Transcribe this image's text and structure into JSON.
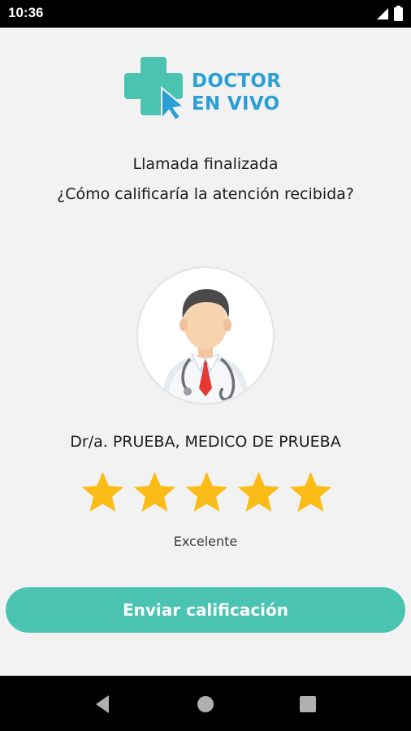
{
  "status_bar": {
    "time": "10:36"
  },
  "logo": {
    "line1": "DOCTOR",
    "line2": "EN VIVO",
    "brand_teal": "#4ac3b1",
    "brand_blue": "#2a9fd6"
  },
  "call": {
    "ended_text": "Llamada finalizada",
    "question": "¿Cómo calificaría la atención recibida?"
  },
  "doctor": {
    "name": "Dr/a. PRUEBA, MEDICO DE PRUEBA"
  },
  "rating": {
    "stars_selected": 5,
    "stars_total": 5,
    "star_color": "#fbbc17",
    "label": "Excelente"
  },
  "submit_button": {
    "label": "Enviar calificación",
    "color": "#4ac3b1"
  },
  "nav": {
    "back": "back-icon",
    "home": "home-icon",
    "recents": "recents-icon"
  }
}
